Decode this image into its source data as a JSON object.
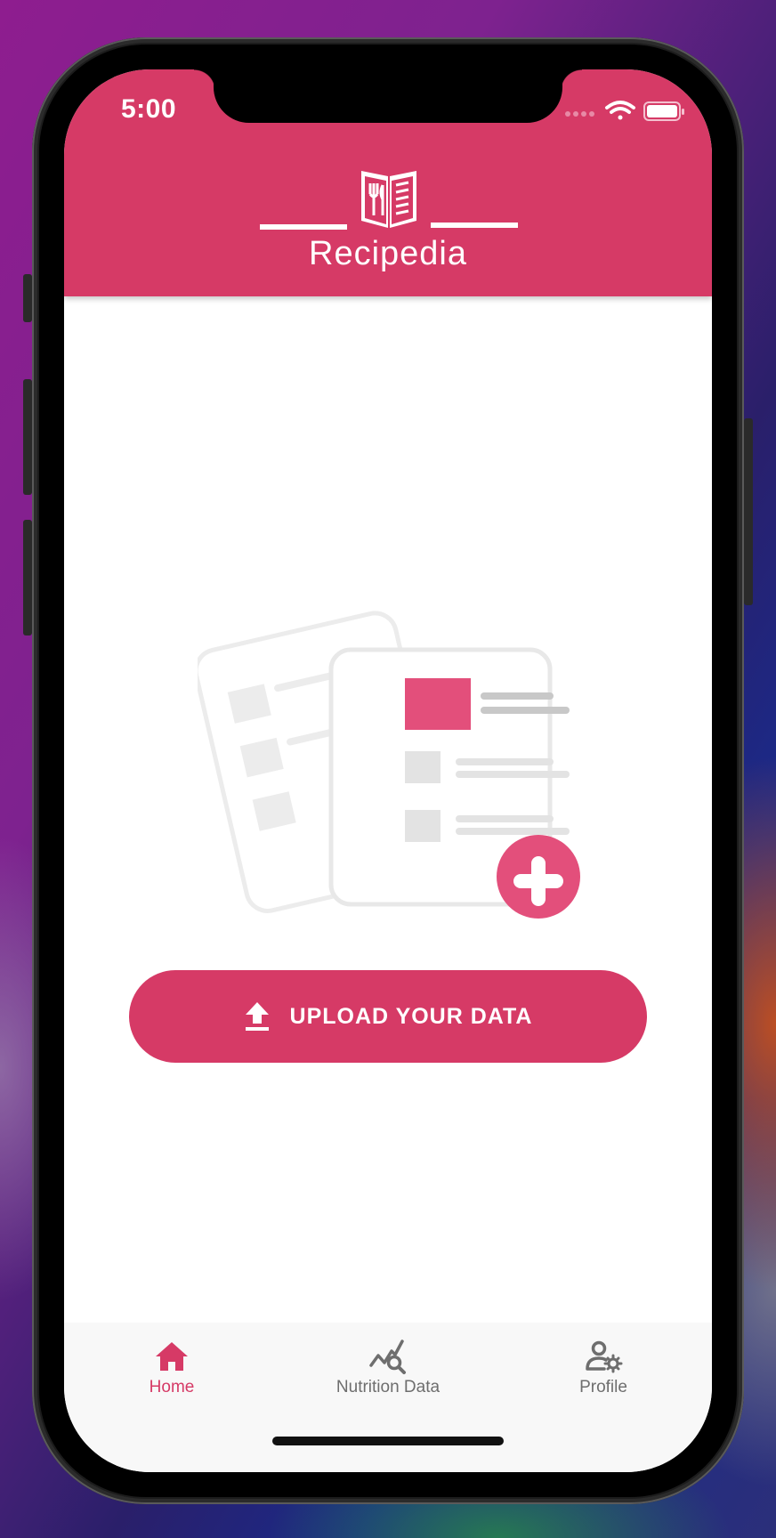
{
  "status_bar": {
    "time": "5:00",
    "icons": [
      "signal-dots-icon",
      "wifi-icon",
      "battery-icon"
    ]
  },
  "header": {
    "logo_icon": "recipe-book-icon",
    "title": "Recipedia"
  },
  "empty_state": {
    "illustration_icon": "documents-add-illustration"
  },
  "upload_button": {
    "icon": "upload-icon",
    "label": "UPLOAD YOUR DATA"
  },
  "bottom_nav": {
    "items": [
      {
        "label": "Home",
        "icon": "home-icon",
        "active": true
      },
      {
        "label": "Nutrition Data",
        "icon": "chart-search-icon",
        "active": false
      },
      {
        "label": "Profile",
        "icon": "user-settings-icon",
        "active": false
      }
    ]
  },
  "colors": {
    "accent": "#d63a66",
    "nav_background": "#f8f8f8",
    "nav_inactive": "#6e6e6e"
  }
}
